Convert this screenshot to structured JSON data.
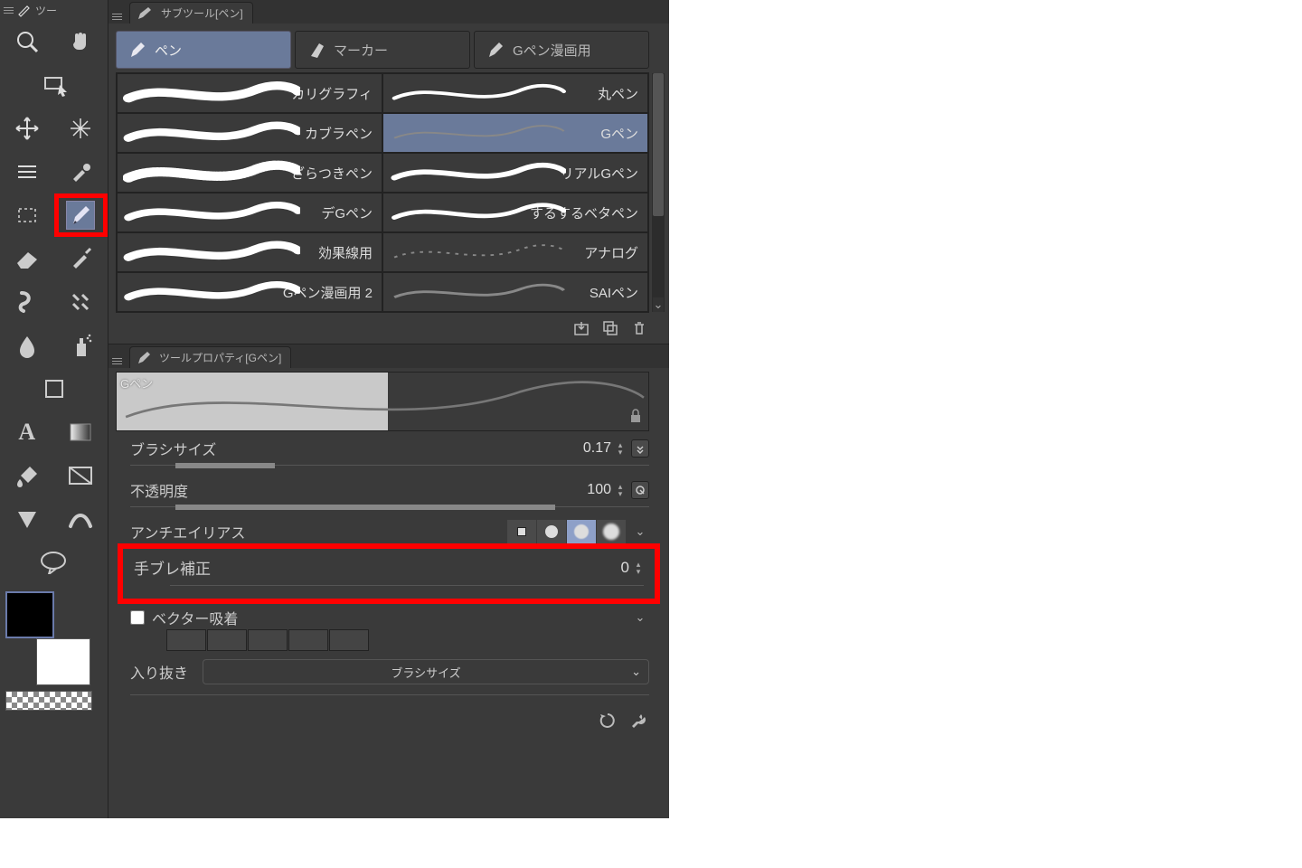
{
  "tool_panel": {
    "title": "ツー"
  },
  "subtool_panel": {
    "title": "サブツール[ペン]",
    "tabs": [
      {
        "label": "ペン",
        "active": true
      },
      {
        "label": "マーカー",
        "active": false
      },
      {
        "label": "Gペン漫画用",
        "active": false
      }
    ],
    "brushes_left": [
      "カリグラフィ",
      "カブラペン",
      "ざらつきペン",
      "デGペン",
      "効果線用",
      "Gペン漫画用 2"
    ],
    "brushes_right": [
      "丸ペン",
      "Gペン",
      "リアルGペン",
      "するするベタペン",
      "アナログ",
      "SAIペン"
    ],
    "selected": "Gペン"
  },
  "property_panel": {
    "title": "ツールプロパティ[Gペン]",
    "preview_label": "Gペン",
    "rows": {
      "brush_size": {
        "label": "ブラシサイズ",
        "value": "0.17"
      },
      "opacity": {
        "label": "不透明度",
        "value": "100"
      },
      "antialias": {
        "label": "アンチエイリアス"
      },
      "stabilize": {
        "label": "手ブレ補正",
        "value": "0"
      },
      "vector": {
        "label": "ベクター吸着"
      },
      "inout": {
        "label": "入り抜き",
        "select": "ブラシサイズ"
      }
    }
  }
}
